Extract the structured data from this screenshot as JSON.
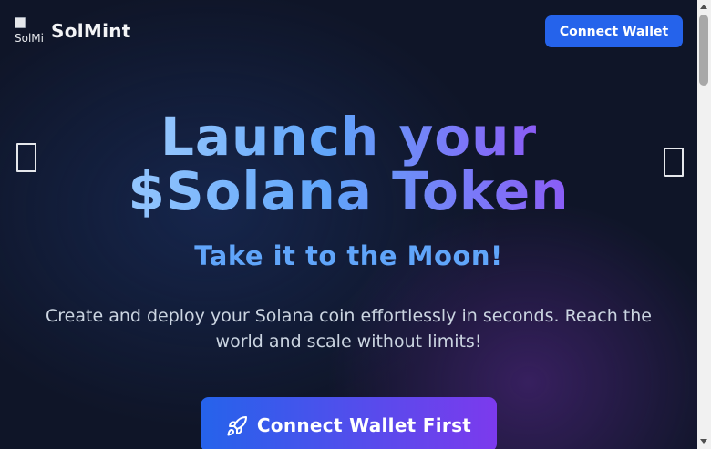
{
  "header": {
    "logo_alt": "SolMint",
    "brand": "SolMint",
    "connect_label": "Connect Wallet"
  },
  "carousel": {
    "prev_icon": "missing-glyph-icon",
    "next_icon": "missing-glyph-icon"
  },
  "hero": {
    "headline_line1": "Launch your",
    "headline_line2": "$Solana Token",
    "subheadline": "Take it to the Moon!",
    "description": "Create and deploy your Solana coin effortlessly in seconds. Reach the world and scale without limits!",
    "cta_label": "Connect Wallet First",
    "cta_icon": "rocket-icon"
  },
  "colors": {
    "background": "#0f1528",
    "primary": "#2563eb",
    "accent_purple": "#7c3aed",
    "subheadline": "#60a5fa"
  }
}
